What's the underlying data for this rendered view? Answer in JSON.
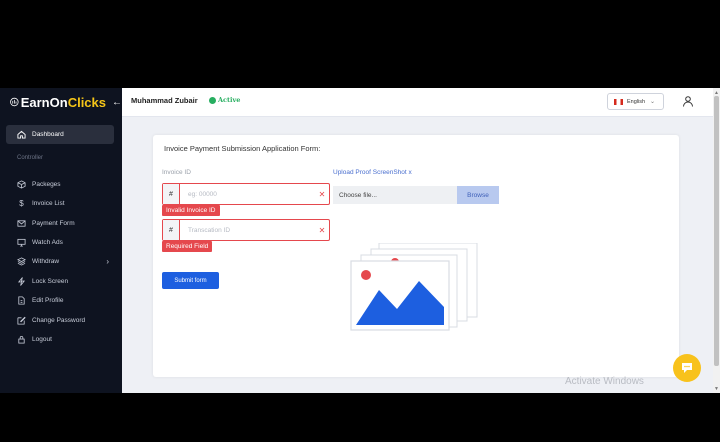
{
  "sidebar": {
    "brand_part1": "EarnOn",
    "brand_part2": "Clicks",
    "collapse_icon": "arrow-left-icon",
    "active_item": {
      "label": "Dashboard",
      "icon": "home-icon"
    },
    "section_title": "Controller",
    "items": [
      {
        "label": "Packeges",
        "icon": "cube-icon"
      },
      {
        "label": "Invoice List",
        "icon": "dollar-icon"
      },
      {
        "label": "Payment Form",
        "icon": "mail-icon"
      },
      {
        "label": "Watch Ads",
        "icon": "monitor-icon"
      },
      {
        "label": "Withdraw",
        "icon": "layers-icon"
      },
      {
        "label": "Lock Screen",
        "icon": "bolt-icon"
      },
      {
        "label": "Edit Profile",
        "icon": "file-icon"
      },
      {
        "label": "Change Password",
        "icon": "edit-icon"
      },
      {
        "label": "Logout",
        "icon": "lock-icon"
      }
    ]
  },
  "header": {
    "user_name": "Muhammad Zubair",
    "status": "Active",
    "language": "English"
  },
  "form": {
    "title": "Invoice Payment Submission Application Form:",
    "invoice_label": "Invoice ID",
    "invoice_prefix": "#",
    "invoice_placeholder": "eg: 00000",
    "invoice_error": "Invalid Invoice ID",
    "transaction_prefix": "#",
    "transaction_placeholder": "Transcation ID",
    "transaction_error": "Required Field",
    "upload_label": "Upload Proof ScreenShot x",
    "file_placeholder": "Choose file...",
    "browse_label": "Browse",
    "submit_label": "Submit form"
  },
  "watermark": "Activate Windows",
  "colors": {
    "sidebar_bg": "#0e1320",
    "accent": "#1d5fe0",
    "error": "#e5484d",
    "active_status": "#27ae60",
    "brand_yellow": "#f5c518"
  }
}
